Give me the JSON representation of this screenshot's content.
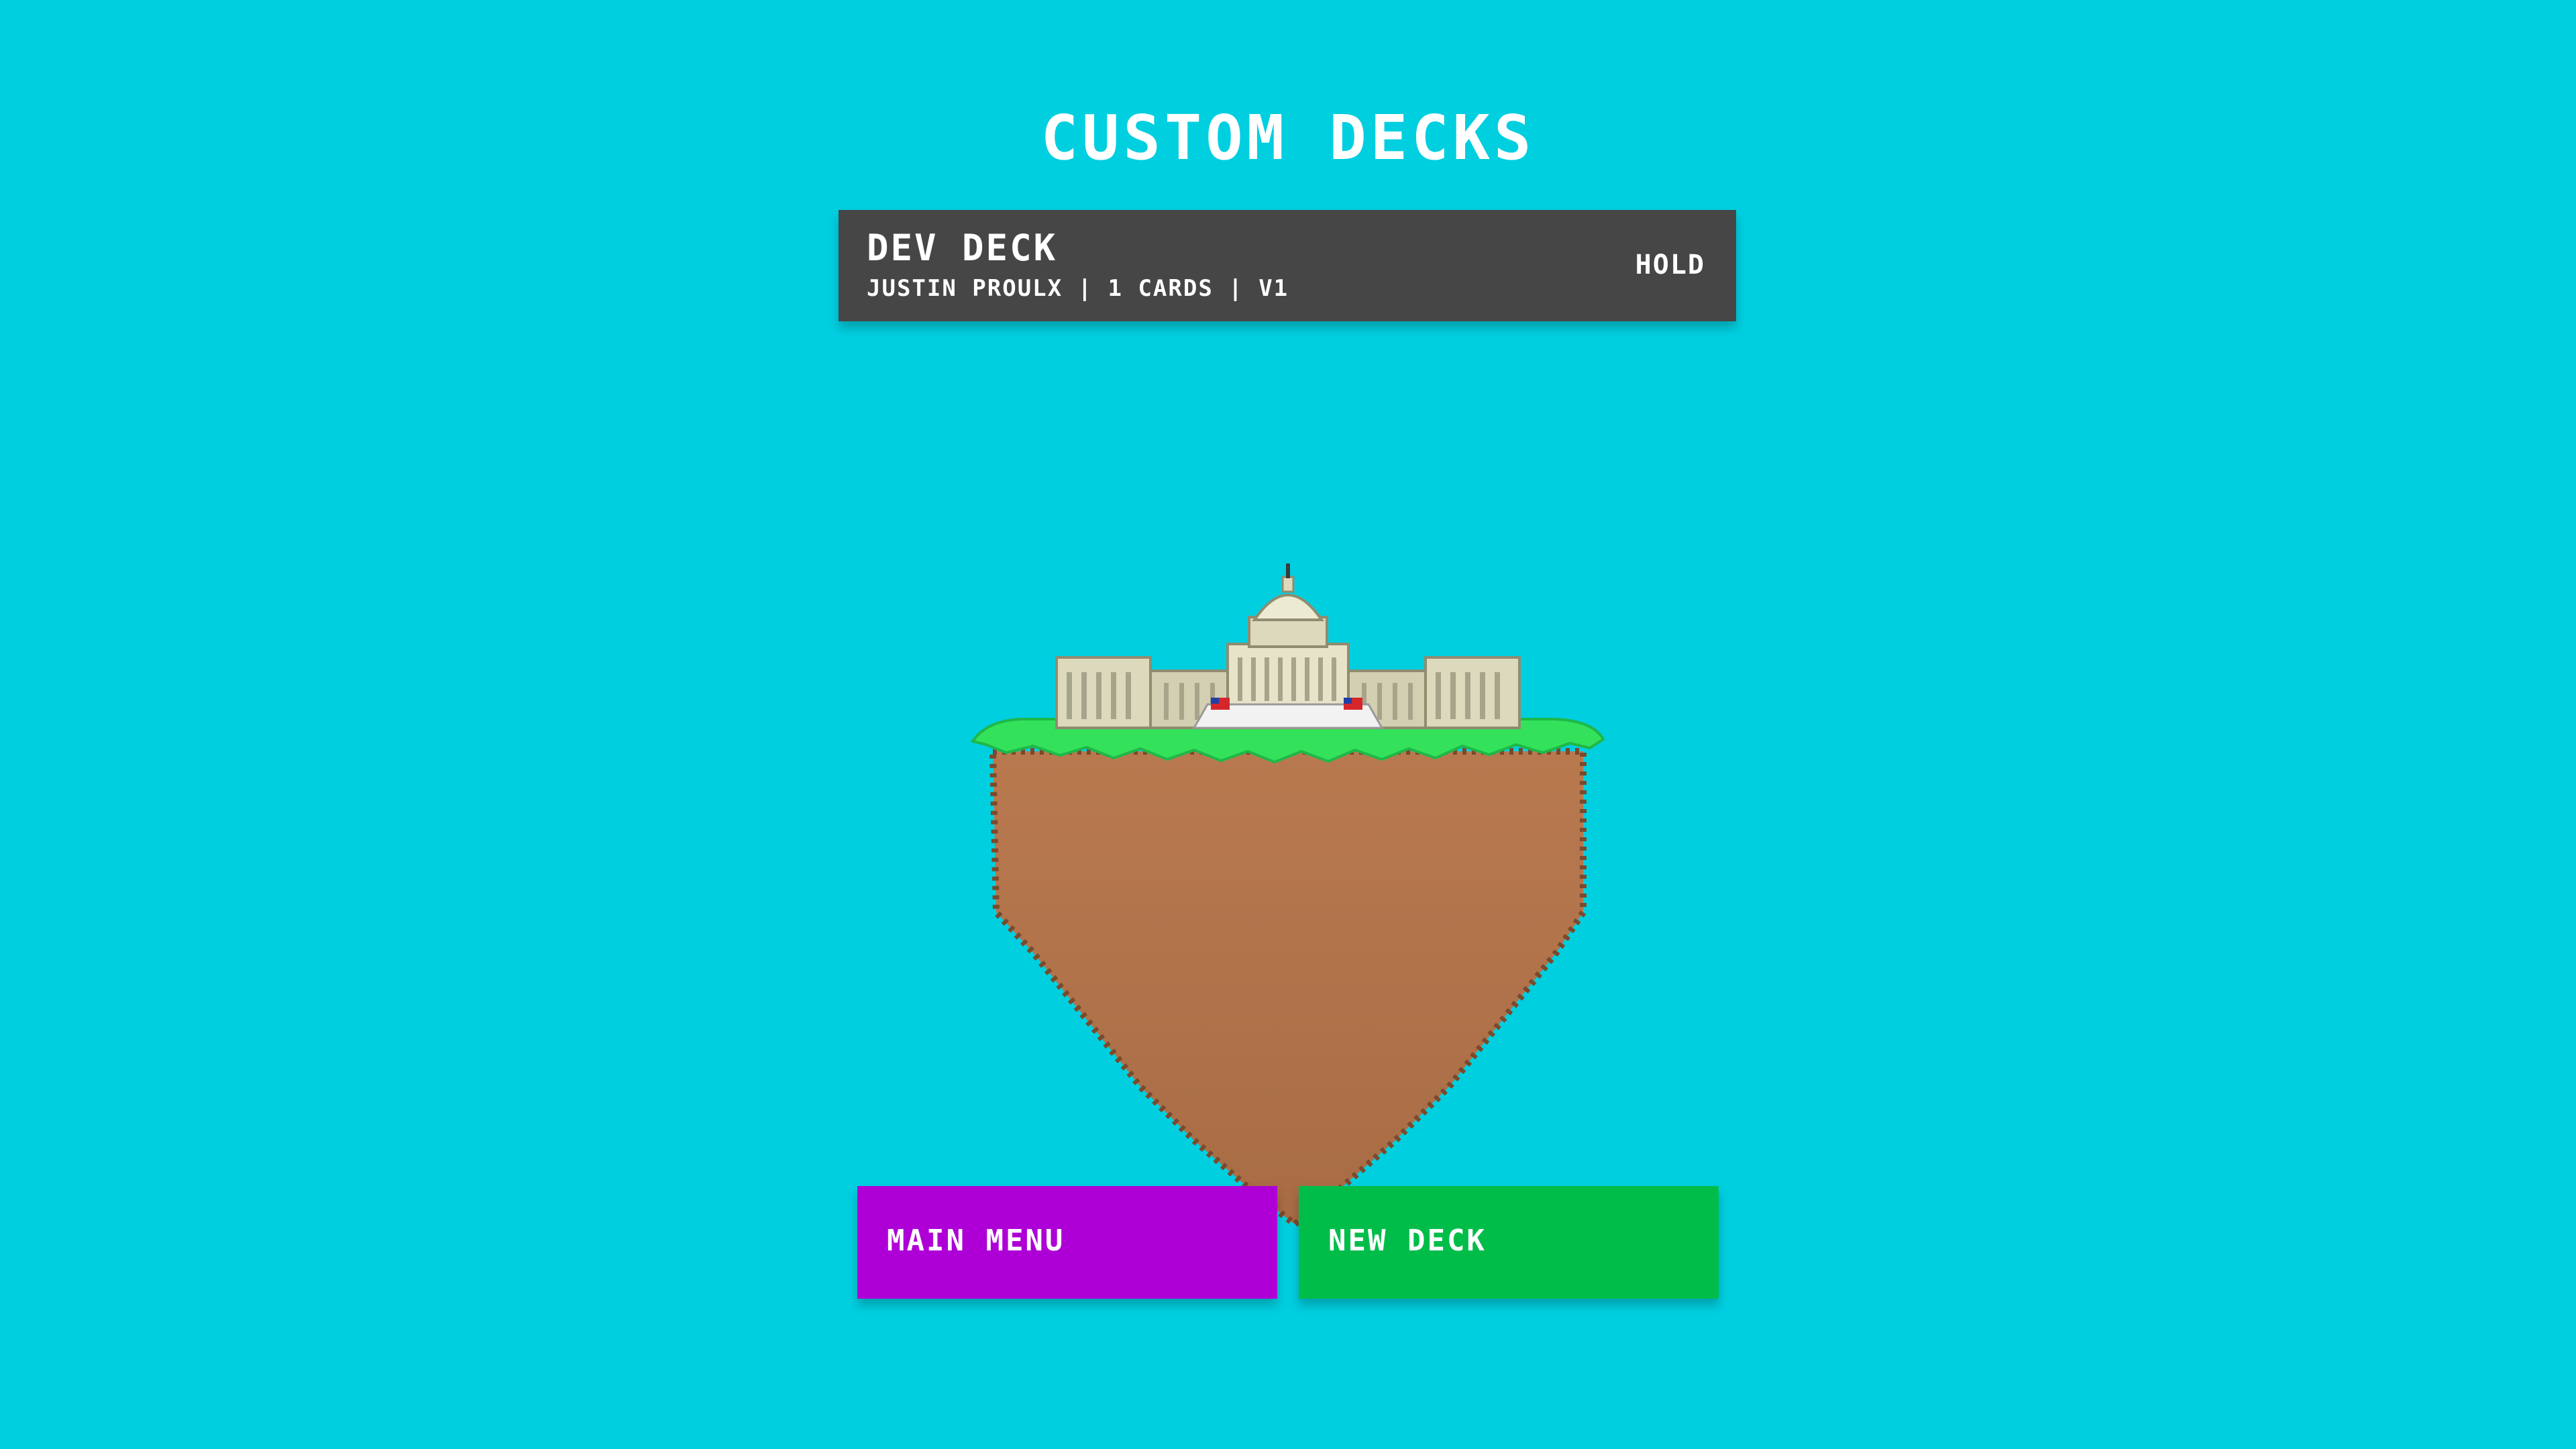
{
  "screen": {
    "title": "CUSTOM DECKS"
  },
  "decks": [
    {
      "name": "DEV DECK",
      "meta": "JUSTIN PROULX | 1 CARDS | V1",
      "action": "HOLD"
    }
  ],
  "buttons": {
    "main_menu": "MAIN MENU",
    "new_deck": "NEW DECK"
  },
  "colors": {
    "background": "#00cfe0",
    "deck_row": "#464646",
    "main_menu_button": "#ae00d6",
    "new_deck_button": "#00bd4a",
    "grass": "#33e25a",
    "dirt": "#b07550"
  },
  "illustration": {
    "icon": "floating-island-capitol-icon"
  }
}
